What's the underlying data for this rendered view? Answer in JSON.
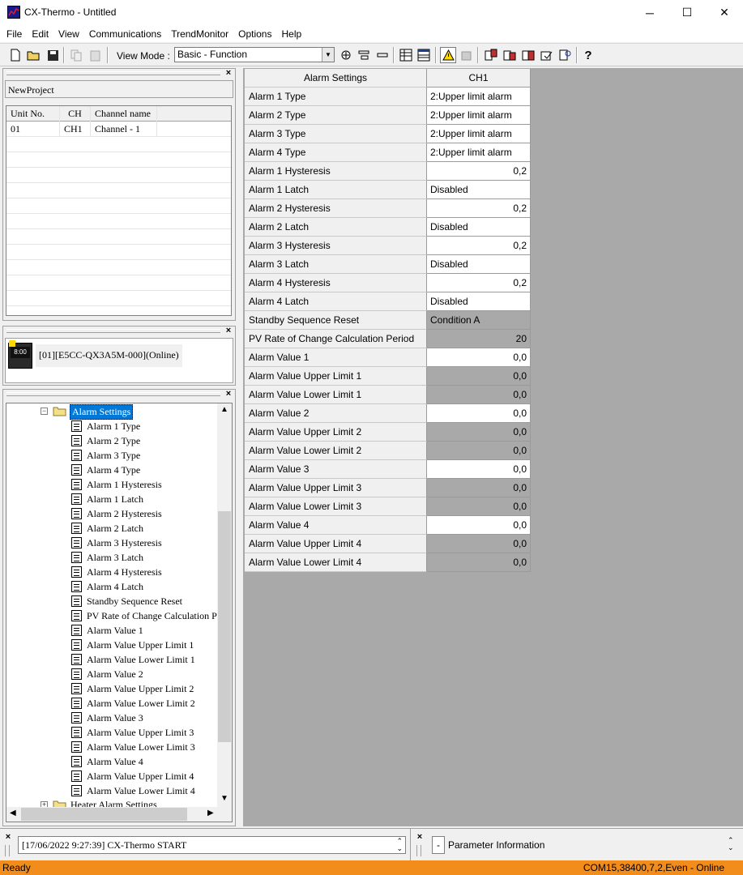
{
  "window": {
    "title": "CX-Thermo - Untitled",
    "minimize": "─",
    "maximize": "☐",
    "close": "✕"
  },
  "menu": [
    "File",
    "Edit",
    "View",
    "Communications",
    "TrendMonitor",
    "Options",
    "Help"
  ],
  "toolbar": {
    "view_mode_label": "View Mode :",
    "view_mode_value": "Basic - Function"
  },
  "project": {
    "name": "NewProject",
    "columns": [
      "Unit No.",
      "CH",
      "Channel name"
    ],
    "rows": [
      [
        "01",
        "CH1",
        "Channel - 1"
      ]
    ]
  },
  "device": {
    "label": "[01][E5CC-QX3A5M-000](Online)"
  },
  "tree": {
    "folder": "Alarm Settings",
    "items": [
      "Alarm 1 Type",
      "Alarm 2 Type",
      "Alarm 3 Type",
      "Alarm 4 Type",
      "Alarm 1 Hysteresis",
      "Alarm 1 Latch",
      "Alarm 2 Hysteresis",
      "Alarm 2 Latch",
      "Alarm 3 Hysteresis",
      "Alarm 3 Latch",
      "Alarm 4 Hysteresis",
      "Alarm 4 Latch",
      "Standby Sequence Reset",
      "PV Rate of Change Calculation Pe",
      "Alarm Value 1",
      "Alarm Value Upper Limit 1",
      "Alarm Value Lower Limit 1",
      "Alarm Value 2",
      "Alarm Value Upper Limit 2",
      "Alarm Value Lower Limit 2",
      "Alarm Value 3",
      "Alarm Value Upper Limit 3",
      "Alarm Value Lower Limit 3",
      "Alarm Value 4",
      "Alarm Value Upper Limit 4",
      "Alarm Value Lower Limit 4"
    ],
    "next_folder": "Heater Alarm Settings"
  },
  "params": {
    "header_name": "Alarm Settings",
    "header_channel": "CH1",
    "rows": [
      {
        "name": "Alarm 1 Type",
        "value": "2:Upper limit alarm",
        "kind": "text"
      },
      {
        "name": "Alarm 2 Type",
        "value": "2:Upper limit alarm",
        "kind": "text"
      },
      {
        "name": "Alarm 3 Type",
        "value": "2:Upper limit alarm",
        "kind": "text"
      },
      {
        "name": "Alarm 4 Type",
        "value": "2:Upper limit alarm",
        "kind": "text"
      },
      {
        "name": "Alarm 1 Hysteresis",
        "value": "0,2",
        "kind": "num"
      },
      {
        "name": "Alarm 1 Latch",
        "value": "Disabled",
        "kind": "text"
      },
      {
        "name": "Alarm 2 Hysteresis",
        "value": "0,2",
        "kind": "num"
      },
      {
        "name": "Alarm 2 Latch",
        "value": "Disabled",
        "kind": "text"
      },
      {
        "name": "Alarm 3 Hysteresis",
        "value": "0,2",
        "kind": "num"
      },
      {
        "name": "Alarm 3 Latch",
        "value": "Disabled",
        "kind": "text"
      },
      {
        "name": "Alarm 4 Hysteresis",
        "value": "0,2",
        "kind": "num"
      },
      {
        "name": "Alarm 4 Latch",
        "value": "Disabled",
        "kind": "text"
      },
      {
        "name": "Standby Sequence Reset",
        "value": "Condition A",
        "kind": "text-gray"
      },
      {
        "name": "PV Rate of Change Calculation Period",
        "value": "20",
        "kind": "num-gray"
      },
      {
        "name": "Alarm Value 1",
        "value": "0,0",
        "kind": "num"
      },
      {
        "name": "Alarm Value Upper Limit 1",
        "value": "0,0",
        "kind": "num-gray"
      },
      {
        "name": "Alarm Value Lower Limit 1",
        "value": "0,0",
        "kind": "num-gray"
      },
      {
        "name": "Alarm Value 2",
        "value": "0,0",
        "kind": "num"
      },
      {
        "name": "Alarm Value Upper Limit 2",
        "value": "0,0",
        "kind": "num-gray"
      },
      {
        "name": "Alarm Value Lower Limit 2",
        "value": "0,0",
        "kind": "num-gray"
      },
      {
        "name": "Alarm Value 3",
        "value": "0,0",
        "kind": "num"
      },
      {
        "name": "Alarm Value Upper Limit 3",
        "value": "0,0",
        "kind": "num-gray"
      },
      {
        "name": "Alarm Value Lower Limit 3",
        "value": "0,0",
        "kind": "num-gray"
      },
      {
        "name": "Alarm Value 4",
        "value": "0,0",
        "kind": "num"
      },
      {
        "name": "Alarm Value Upper Limit 4",
        "value": "0,0",
        "kind": "num-gray"
      },
      {
        "name": "Alarm Value Lower Limit 4",
        "value": "0,0",
        "kind": "num-gray"
      }
    ]
  },
  "log": {
    "message": "[17/06/2022 9:27:39] CX-Thermo START",
    "param_info_button": "-",
    "param_info_label": "Parameter Information"
  },
  "status": {
    "left": "Ready",
    "right": "COM15,38400,7,2,Even - Online"
  },
  "colors": {
    "status_bar": "#f28c1a",
    "selection": "#0078d7",
    "disabled_cell": "#a9a9a9"
  }
}
